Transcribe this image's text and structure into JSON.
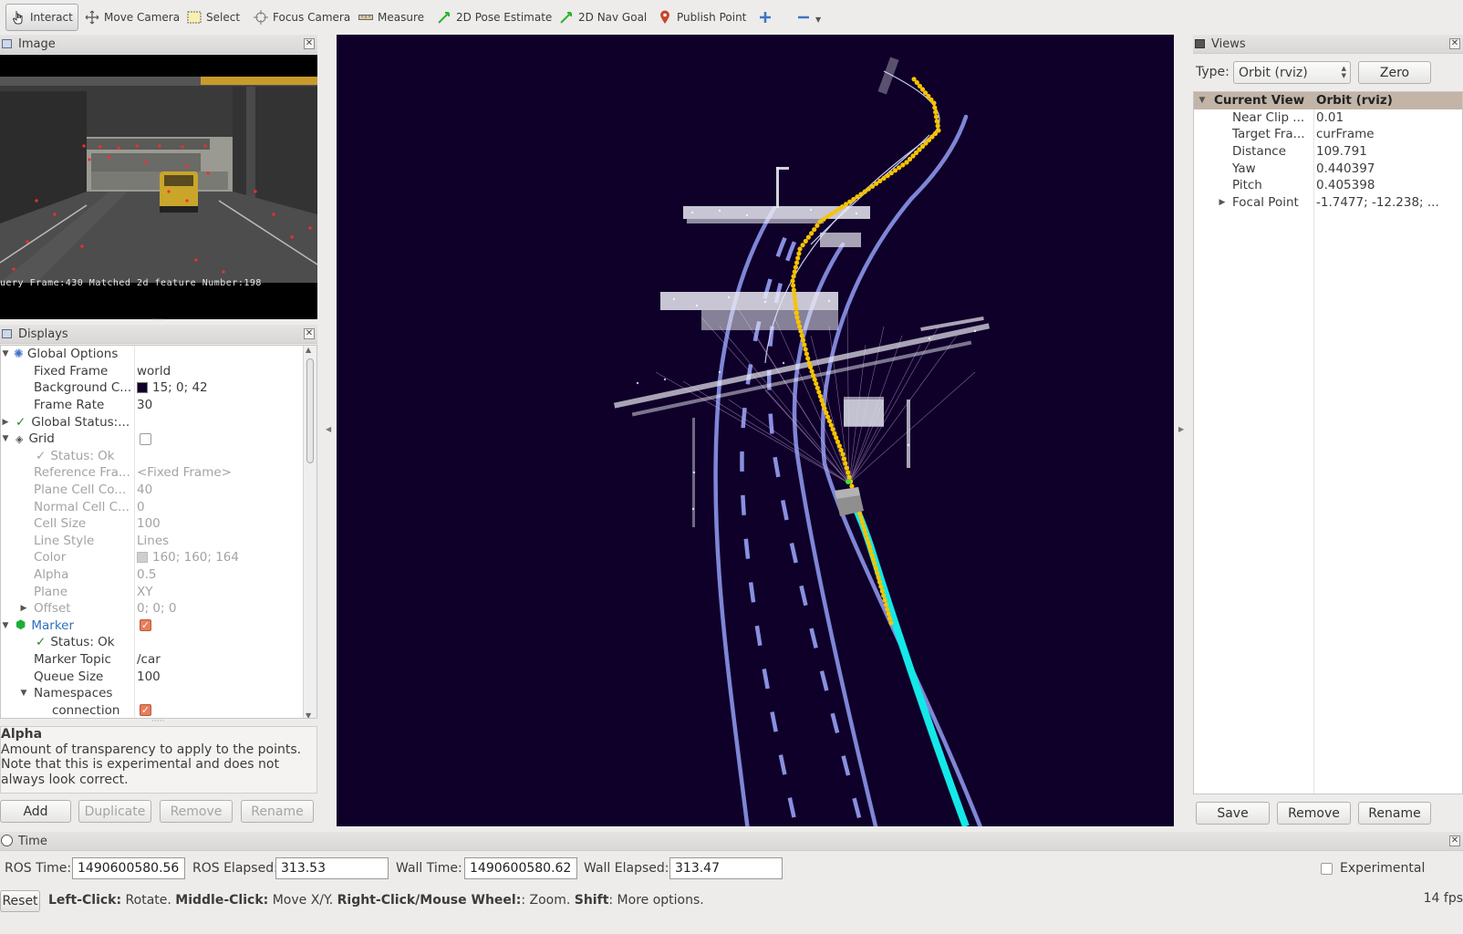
{
  "toolbar": {
    "tools": [
      {
        "label": "Interact",
        "icon": "hand-pointer-icon"
      },
      {
        "label": "Move Camera",
        "icon": "move-arrows-icon"
      },
      {
        "label": "Select",
        "icon": "select-rect-icon"
      },
      {
        "label": "Focus Camera",
        "icon": "focus-crosshair-icon"
      },
      {
        "label": "Measure",
        "icon": "ruler-icon"
      },
      {
        "label": "2D Pose Estimate",
        "icon": "green-arrow-icon"
      },
      {
        "label": "2D Nav Goal",
        "icon": "green-arrow-icon"
      },
      {
        "label": "Publish Point",
        "icon": "map-pin-icon"
      }
    ]
  },
  "image_panel": {
    "title": "Image",
    "caption": "uery Frame:430  Matched 2d feature Number:198"
  },
  "displays_panel": {
    "title": "Displays",
    "rows": {
      "global_options": {
        "label": "Global Options"
      },
      "fixed_frame": {
        "label": "Fixed Frame",
        "value": "world"
      },
      "background_color": {
        "label": "Background C...",
        "value": "15; 0; 42",
        "color": "#0f002a"
      },
      "frame_rate": {
        "label": "Frame Rate",
        "value": "30"
      },
      "global_status": {
        "label": "Global Status:..."
      },
      "grid": {
        "label": "Grid",
        "checked": false
      },
      "grid_status": {
        "label": "Status: Ok"
      },
      "reference_frame": {
        "label": "Reference Fra...",
        "value": "<Fixed Frame>"
      },
      "plane_cell_count": {
        "label": "Plane Cell Co...",
        "value": "40"
      },
      "normal_cell_count": {
        "label": "Normal Cell C...",
        "value": "0"
      },
      "cell_size": {
        "label": "Cell Size",
        "value": "100"
      },
      "line_style": {
        "label": "Line Style",
        "value": "Lines"
      },
      "color": {
        "label": "Color",
        "value": "160; 160; 164",
        "color": "#a0a0a4"
      },
      "alpha": {
        "label": "Alpha",
        "value": "0.5"
      },
      "plane": {
        "label": "Plane",
        "value": "XY"
      },
      "offset": {
        "label": "Offset",
        "value": "0; 0; 0"
      },
      "marker": {
        "label": "Marker",
        "checked": true
      },
      "marker_status": {
        "label": "Status: Ok"
      },
      "marker_topic": {
        "label": "Marker Topic",
        "value": "/car"
      },
      "queue_size": {
        "label": "Queue Size",
        "value": "100"
      },
      "namespaces": {
        "label": "Namespaces"
      },
      "connection": {
        "label": "connection",
        "checked": true
      }
    }
  },
  "description": {
    "title": "Alpha",
    "text": "Amount of transparency to apply to the points. Note that this is experimental and does not always look correct."
  },
  "display_buttons": {
    "add": "Add",
    "duplicate": "Duplicate",
    "remove": "Remove",
    "rename": "Rename"
  },
  "views_panel": {
    "title": "Views",
    "type_label": "Type:",
    "type_value": "Orbit (rviz)",
    "zero_label": "Zero",
    "current_view": {
      "label": "Current View",
      "value": "Orbit (rviz)"
    },
    "props": [
      {
        "label": "Near Clip ...",
        "value": "0.01"
      },
      {
        "label": "Target Fra...",
        "value": "curFrame"
      },
      {
        "label": "Distance",
        "value": "109.791"
      },
      {
        "label": "Yaw",
        "value": "0.440397"
      },
      {
        "label": "Pitch",
        "value": "0.405398"
      },
      {
        "label": "Focal Point",
        "value": "-1.7477; -12.238; ..."
      }
    ],
    "buttons": {
      "save": "Save",
      "remove": "Remove",
      "rename": "Rename"
    }
  },
  "time_panel": {
    "title": "Time",
    "ros_time_label": "ROS Time:",
    "ros_time": "1490600580.56",
    "ros_elapsed_label": "ROS Elapsed:",
    "ros_elapsed": "313.53",
    "wall_time_label": "Wall Time:",
    "wall_time": "1490600580.62",
    "wall_elapsed_label": "Wall Elapsed:",
    "wall_elapsed": "313.47",
    "experimental_label": "Experimental",
    "experimental_checked": false
  },
  "status_bar": {
    "reset_label": "Reset",
    "hint_parts": [
      {
        "text": "Left-Click:",
        "bold": true
      },
      {
        "text": " Rotate. ",
        "bold": false
      },
      {
        "text": "Middle-Click:",
        "bold": true
      },
      {
        "text": " Move X/Y. ",
        "bold": false
      },
      {
        "text": "Right-Click/Mouse Wheel:",
        "bold": true
      },
      {
        "text": ": Zoom. ",
        "bold": false
      },
      {
        "text": "Shift",
        "bold": true
      },
      {
        "text": ": More options.",
        "bold": false
      }
    ],
    "fps": "14 fps"
  },
  "colors": {
    "scene_background": "#0f002a",
    "lane_line": "#7f86d6",
    "trajectory": "#f5c400",
    "cyan_path": "#14e8e8"
  }
}
